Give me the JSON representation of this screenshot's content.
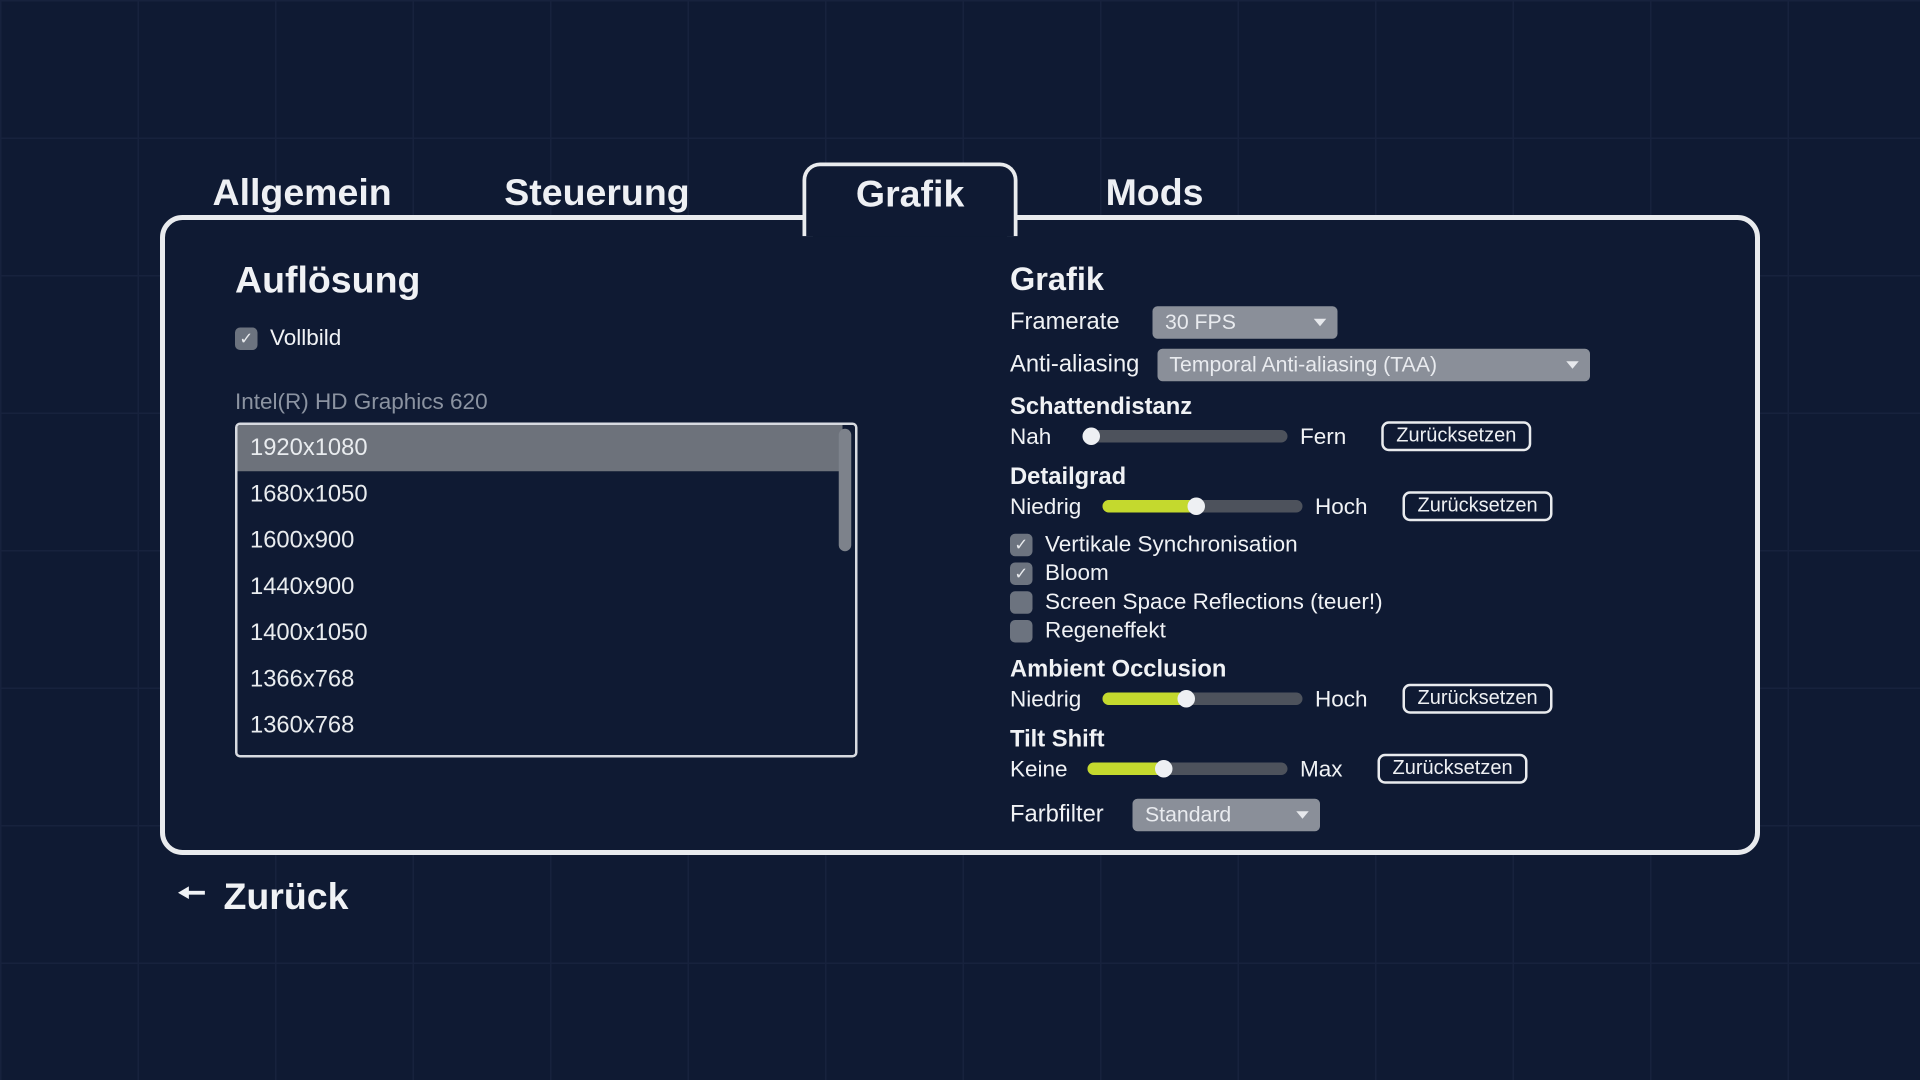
{
  "tabs": {
    "general": "Allgemein",
    "controls": "Steuerung",
    "graphics": "Grafik",
    "mods": "Mods",
    "active": "graphics"
  },
  "left": {
    "heading": "Auflösung",
    "fullscreen_label": "Vollbild",
    "fullscreen_checked": true,
    "gpu": "Intel(R) HD Graphics 620",
    "resolutions": [
      "1920x1080",
      "1680x1050",
      "1600x900",
      "1440x900",
      "1400x1050",
      "1366x768",
      "1360x768"
    ],
    "selected_resolution": "1920x1080"
  },
  "right": {
    "heading": "Grafik",
    "framerate_label": "Framerate",
    "framerate_value": "30 FPS",
    "aa_label": "Anti-aliasing",
    "aa_value": "Temporal Anti-aliasing (TAA)",
    "shadow": {
      "title": "Schattendistanz",
      "low": "Nah",
      "high": "Fern",
      "value": 0.02
    },
    "detail": {
      "title": "Detailgrad",
      "low": "Niedrig",
      "high": "Hoch",
      "value": 0.47
    },
    "checks": {
      "vsync": {
        "label": "Vertikale Synchronisation",
        "checked": true
      },
      "bloom": {
        "label": "Bloom",
        "checked": true
      },
      "ssr": {
        "label": "Screen Space Reflections (teuer!)",
        "checked": false
      },
      "rain": {
        "label": "Regeneffekt",
        "checked": false
      }
    },
    "ao": {
      "title": "Ambient Occlusion",
      "low": "Niedrig",
      "high": "Hoch",
      "value": 0.42
    },
    "tilt": {
      "title": "Tilt Shift",
      "low": "Keine",
      "high": "Max",
      "value": 0.38
    },
    "colorfilter_label": "Farbfilter",
    "colorfilter_value": "Standard",
    "reset_label": "Zurücksetzen"
  },
  "back_label": "Zurück"
}
